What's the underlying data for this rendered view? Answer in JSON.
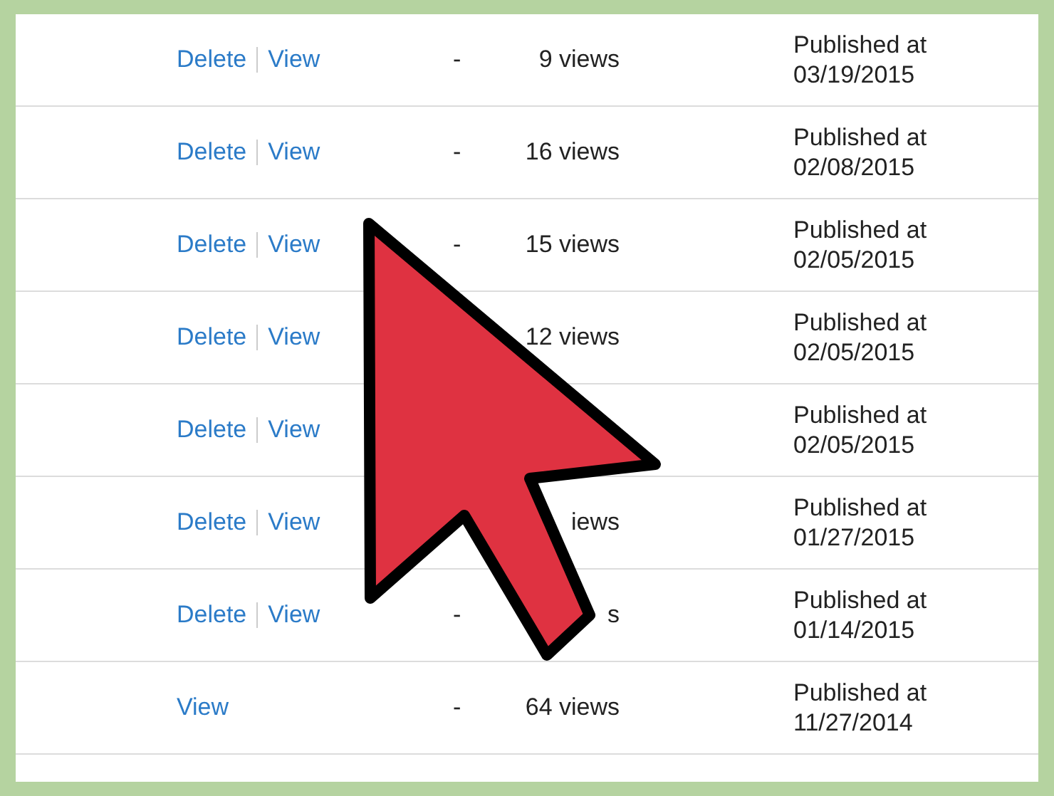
{
  "rows": [
    {
      "actions": [
        {
          "label": "Delete"
        },
        {
          "label": "View"
        }
      ],
      "dash": "-",
      "views": "9 views",
      "published_label": "Published at",
      "date": "03/19/2015"
    },
    {
      "actions": [
        {
          "label": "Delete"
        },
        {
          "label": "View"
        }
      ],
      "dash": "-",
      "views": "16 views",
      "published_label": "Published at",
      "date": "02/08/2015"
    },
    {
      "actions": [
        {
          "label": "Delete"
        },
        {
          "label": "View"
        }
      ],
      "dash": "-",
      "views": "15 views",
      "published_label": "Published at",
      "date": "02/05/2015"
    },
    {
      "actions": [
        {
          "label": "Delete"
        },
        {
          "label": "View"
        }
      ],
      "views": "12 views",
      "published_label": "Published at",
      "date": "02/05/2015"
    },
    {
      "actions": [
        {
          "label": "Delete"
        },
        {
          "label": "View"
        }
      ],
      "published_label": "Published at",
      "date": "02/05/2015"
    },
    {
      "actions": [
        {
          "label": "Delete"
        },
        {
          "label": "View"
        }
      ],
      "views": "iews",
      "published_label": "Published at",
      "date": "01/27/2015"
    },
    {
      "actions": [
        {
          "label": "Delete"
        },
        {
          "label": "View"
        }
      ],
      "dash": "-",
      "views": "s",
      "published_label": "Published at",
      "date": "01/14/2015"
    },
    {
      "actions": [
        {
          "label": "View"
        }
      ],
      "dash": "-",
      "views": "64 views",
      "published_label": "Published at",
      "date": "11/27/2014"
    }
  ]
}
